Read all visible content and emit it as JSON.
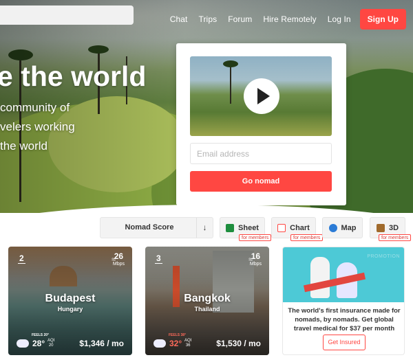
{
  "nav": {
    "links": [
      "Chat",
      "Trips",
      "Forum",
      "Hire Remotely",
      "Log In"
    ],
    "signup": "Sign Up"
  },
  "hero": {
    "headline": "e the world",
    "sub_lines": [
      "community of",
      "velers working",
      "the world"
    ]
  },
  "signup_card": {
    "email_placeholder": "Email address",
    "submit": "Go nomad"
  },
  "toolbar": {
    "sort_label": "Nomad Score",
    "sort_arrow": "↓",
    "views": [
      {
        "label": "Sheet",
        "badge": "for members",
        "icon_color": "#1e8e3e"
      },
      {
        "label": "Chart",
        "badge": "for members",
        "icon_color": "#ff4742"
      },
      {
        "label": "Map",
        "badge": "",
        "icon_color": "#2b7bd6"
      },
      {
        "label": "3D",
        "badge": "for members",
        "icon_color": "#a06a2c"
      }
    ]
  },
  "cities": [
    {
      "rank": "2",
      "speed": "26",
      "speed_unit": "Mbps",
      "name": "Budapest",
      "country": "Hungary",
      "feels": "FEELS 20°",
      "temp": "28°",
      "aqi_label": "AQI",
      "aqi": "20",
      "cost": "$1,346 / mo",
      "weather_icon": "cloud-icon"
    },
    {
      "rank": "3",
      "speed": "16",
      "speed_unit": "Mbps",
      "name": "Bangkok",
      "country": "Thailand",
      "feels": "FEELS 38°",
      "temp": "32°",
      "aqi_label": "AQI",
      "aqi": "36",
      "cost": "$1,530 / mo",
      "weather_icon": "rain-cloud-icon"
    }
  ],
  "promo": {
    "tag": "PROMOTION",
    "text": "The world's first insurance made for nomads, by nomads. Get global travel medical for $37 per month",
    "button": "Get Insured"
  }
}
